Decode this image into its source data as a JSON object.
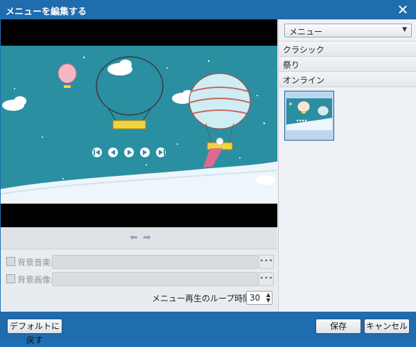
{
  "window": {
    "title": "メニューを編集する",
    "close_glyph": "✕"
  },
  "preview": {
    "nav_prev": "⬅",
    "nav_next": "➡"
  },
  "options": {
    "bg_music_label": "背景音楽:",
    "bg_image_label": "背景画像:",
    "browse_label": "•••",
    "loop_label": "メニュー再生のループ時間(秒):",
    "loop_value": "30"
  },
  "panel": {
    "select_value": "メニュー",
    "categories": [
      "クラシック",
      "祭り",
      "オンライン"
    ]
  },
  "footer": {
    "default_button": "デフォルトに戻す",
    "save_button": "保存",
    "cancel_button": "キャンセル"
  },
  "colors": {
    "titlebar": "#1f6cae",
    "preview_bg": "#2b8fa2",
    "gondola": "#f2d53c"
  }
}
